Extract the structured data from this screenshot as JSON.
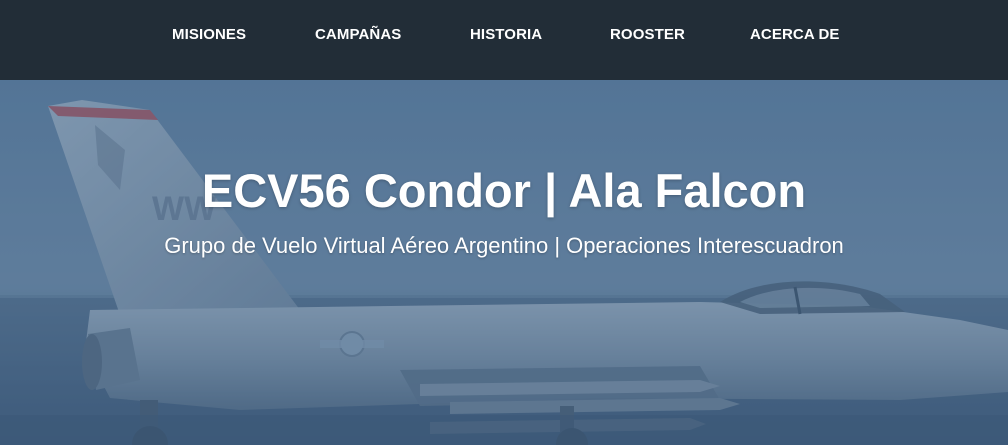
{
  "nav": {
    "items": [
      {
        "label": "MISIONES"
      },
      {
        "label": "CAMPAÑAS"
      },
      {
        "label": "HISTORIA"
      },
      {
        "label": "ROOSTER"
      },
      {
        "label": "ACERCA DE"
      }
    ]
  },
  "hero": {
    "title": "ECV56 Condor | Ala Falcon",
    "subtitle": "Grupo de Vuelo Virtual Aéreo Argentino | Operaciones Interescuadron",
    "background": "fighter-jet-photo",
    "tail_text": "WW"
  },
  "colors": {
    "navbar_bg": "#222d37",
    "hero_tint": "#4a6a8c",
    "text": "#ffffff"
  }
}
